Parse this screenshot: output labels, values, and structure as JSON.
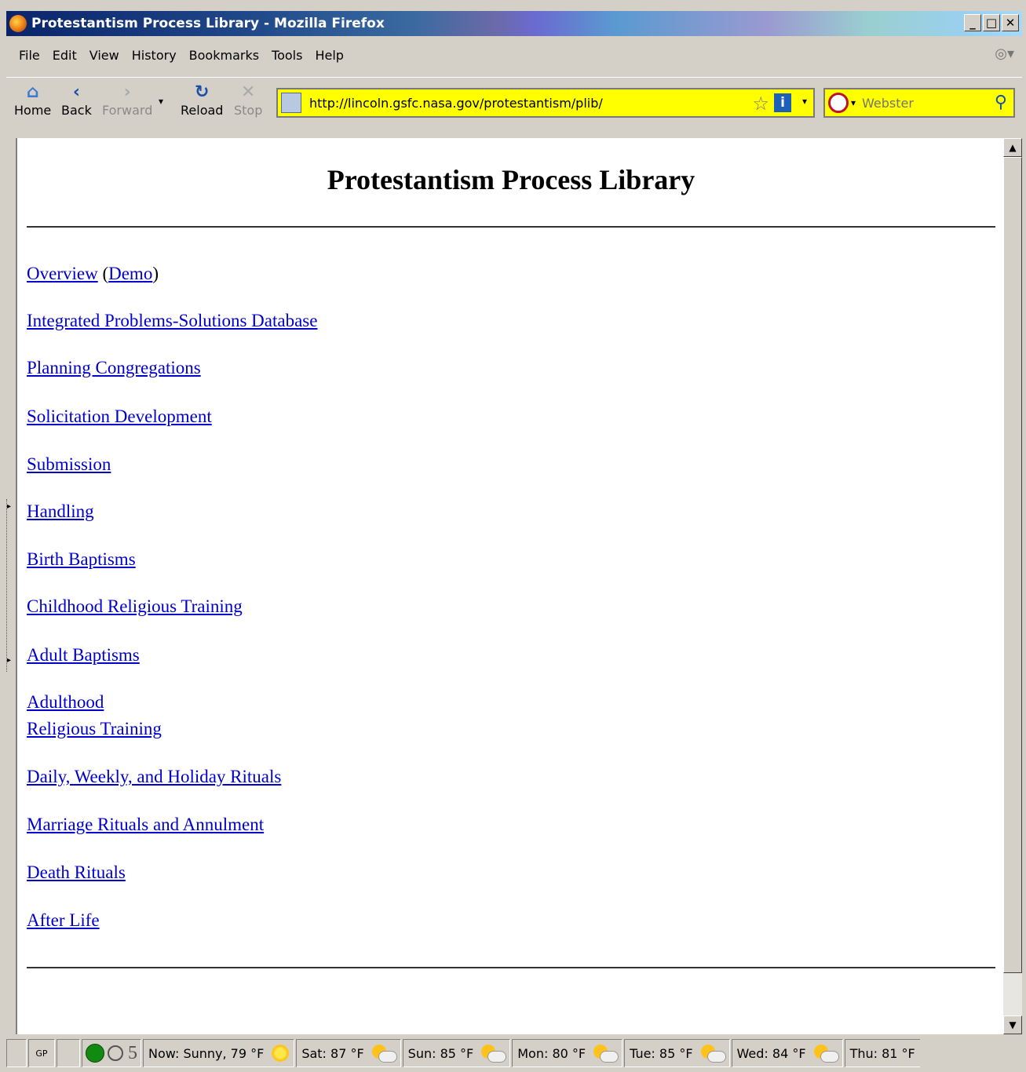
{
  "window": {
    "title": "Protestantism Process Library - Mozilla Firefox",
    "minimize": "_",
    "maximize": "□",
    "close": "✕"
  },
  "menu": [
    "File",
    "Edit",
    "View",
    "History",
    "Bookmarks",
    "Tools",
    "Help"
  ],
  "toolbar": {
    "home": "Home",
    "back": "Back",
    "forward": "Forward",
    "reload": "Reload",
    "stop": "Stop",
    "url": "http://lincoln.gsfc.nasa.gov/protestantism/plib/",
    "search_placeholder": "Webster"
  },
  "page": {
    "title": "Protestantism Process Library",
    "overview": "Overview",
    "open_paren": "(",
    "demo": "Demo",
    "close_paren": ")",
    "links": [
      "Integrated Problems-Solutions Database",
      "Planning Congregations",
      "Solicitation Development",
      "Submission",
      "Handling",
      "Birth Baptisms",
      "Childhood Religious Training",
      "Adult Baptisms",
      "Adulthood",
      "Religious Training",
      "Daily, Weekly, and Holiday Rituals",
      "Marriage Rituals and Annulment",
      "Death Rituals",
      "After Life"
    ]
  },
  "status": {
    "gp": "GP",
    "count": "5",
    "now": "Now: Sunny, 79 °F",
    "forecast": [
      "Sat: 87 °F",
      "Sun: 85 °F",
      "Mon: 80 °F",
      "Tue: 85 °F",
      "Wed: 84 °F",
      "Thu: 81 °F"
    ]
  }
}
